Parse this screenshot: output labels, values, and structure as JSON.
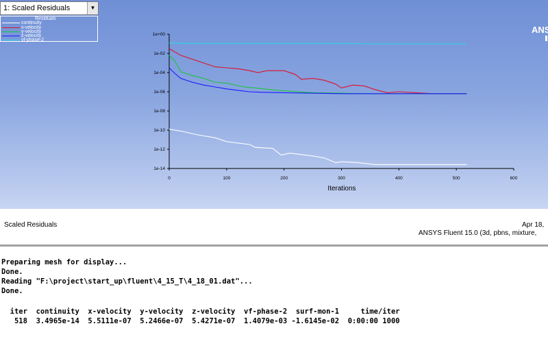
{
  "window_select": {
    "value": "1: Scaled Residuals"
  },
  "legend": {
    "title": "Residuals",
    "items": [
      {
        "name": "continuity",
        "color": "#ffffff"
      },
      {
        "name": "x-velocity",
        "color": "#e0102a"
      },
      {
        "name": "y-velocity",
        "color": "#19c43a"
      },
      {
        "name": "z-velocity",
        "color": "#1a1aff"
      },
      {
        "name": "vf-phase-2",
        "color": "#29d6e6"
      }
    ]
  },
  "brand": {
    "text": "ANSYS"
  },
  "chart_data": {
    "type": "line",
    "xlabel": "Iterations",
    "ylabel": "",
    "xlim": [
      0,
      600
    ],
    "ylim_log10": [
      -14,
      0
    ],
    "log_scale_y": true,
    "x_ticks": [
      "0",
      "100",
      "200",
      "300",
      "400",
      "500",
      "600"
    ],
    "y_ticks": [
      "1e+00",
      "1e-02",
      "1e-04",
      "1e-06",
      "1e-08",
      "1e-10",
      "1e-12",
      "1e-14"
    ],
    "series": [
      {
        "name": "continuity",
        "color": "#ffffff",
        "points_log10": [
          [
            0,
            -9.9
          ],
          [
            20,
            -10.1
          ],
          [
            50,
            -10.5
          ],
          [
            80,
            -10.8
          ],
          [
            100,
            -11.2
          ],
          [
            140,
            -11.5
          ],
          [
            150,
            -11.8
          ],
          [
            180,
            -11.9
          ],
          [
            195,
            -12.6
          ],
          [
            210,
            -12.4
          ],
          [
            250,
            -12.7
          ],
          [
            270,
            -12.9
          ],
          [
            290,
            -13.4
          ],
          [
            300,
            -13.3
          ],
          [
            330,
            -13.4
          ],
          [
            360,
            -13.6
          ],
          [
            400,
            -13.6
          ],
          [
            450,
            -13.6
          ],
          [
            518,
            -13.6
          ]
        ]
      },
      {
        "name": "x-velocity",
        "color": "#e0102a",
        "points_log10": [
          [
            0,
            -1.5
          ],
          [
            20,
            -2.2
          ],
          [
            40,
            -2.6
          ],
          [
            60,
            -3.0
          ],
          [
            80,
            -3.4
          ],
          [
            100,
            -3.5
          ],
          [
            120,
            -3.6
          ],
          [
            140,
            -3.8
          ],
          [
            155,
            -4.0
          ],
          [
            170,
            -3.8
          ],
          [
            200,
            -3.8
          ],
          [
            220,
            -4.2
          ],
          [
            230,
            -4.7
          ],
          [
            250,
            -4.6
          ],
          [
            270,
            -4.8
          ],
          [
            290,
            -5.2
          ],
          [
            300,
            -5.6
          ],
          [
            320,
            -5.3
          ],
          [
            340,
            -5.4
          ],
          [
            360,
            -5.8
          ],
          [
            380,
            -6.1
          ],
          [
            400,
            -6.0
          ],
          [
            430,
            -6.1
          ],
          [
            460,
            -6.2
          ],
          [
            490,
            -6.2
          ],
          [
            518,
            -6.2
          ]
        ]
      },
      {
        "name": "y-velocity",
        "color": "#19c43a",
        "points_log10": [
          [
            0,
            -2.2
          ],
          [
            10,
            -2.8
          ],
          [
            20,
            -3.9
          ],
          [
            40,
            -4.3
          ],
          [
            60,
            -4.6
          ],
          [
            80,
            -5.0
          ],
          [
            100,
            -5.1
          ],
          [
            130,
            -5.5
          ],
          [
            150,
            -5.6
          ],
          [
            180,
            -5.8
          ],
          [
            200,
            -5.9
          ],
          [
            250,
            -6.1
          ],
          [
            300,
            -6.15
          ],
          [
            350,
            -6.2
          ],
          [
            400,
            -6.2
          ],
          [
            450,
            -6.2
          ],
          [
            518,
            -6.2
          ]
        ]
      },
      {
        "name": "z-velocity",
        "color": "#1a1aff",
        "points_log10": [
          [
            0,
            -3.5
          ],
          [
            10,
            -4.1
          ],
          [
            20,
            -4.6
          ],
          [
            40,
            -5.0
          ],
          [
            60,
            -5.3
          ],
          [
            80,
            -5.5
          ],
          [
            100,
            -5.7
          ],
          [
            120,
            -5.85
          ],
          [
            140,
            -6.0
          ],
          [
            160,
            -6.05
          ],
          [
            200,
            -6.1
          ],
          [
            250,
            -6.15
          ],
          [
            300,
            -6.2
          ],
          [
            400,
            -6.2
          ],
          [
            518,
            -6.2
          ]
        ]
      },
      {
        "name": "vf-phase-2",
        "color": "#29d6e6",
        "points_log10": [
          [
            0,
            -0.9
          ],
          [
            30,
            -0.95
          ],
          [
            100,
            -0.95
          ],
          [
            200,
            -0.95
          ],
          [
            300,
            -0.95
          ],
          [
            350,
            -1.0
          ],
          [
            400,
            -1.0
          ],
          [
            518,
            -1.0
          ]
        ]
      }
    ]
  },
  "footer": {
    "title": "Scaled Residuals",
    "date": "Apr 18,",
    "product": "ANSYS Fluent 15.0 (3d, pbns, mixture,"
  },
  "console": {
    "lines": [
      "Preparing mesh for display...",
      "Done.",
      "Reading \"F:\\project\\start_up\\fluent\\4_15_T\\4_18_01.dat\"...",
      "Done.",
      "",
      "  iter  continuity  x-velocity  y-velocity  z-velocity  vf-phase-2  surf-mon-1     time/iter",
      "   518  3.4965e-14  5.5111e-07  5.2466e-07  5.4271e-07  1.4079e-03 -1.6145e-02  0:00:00 1000"
    ]
  }
}
